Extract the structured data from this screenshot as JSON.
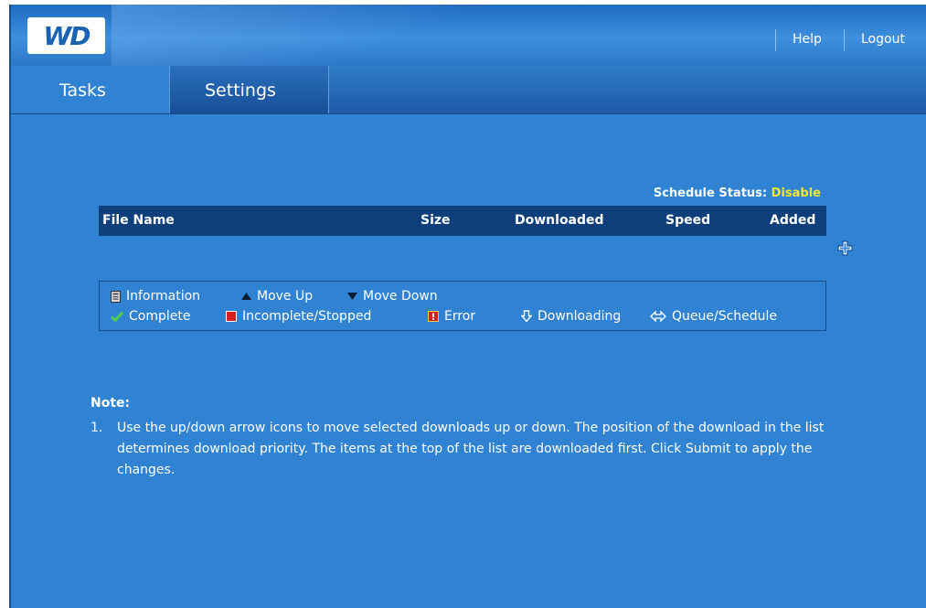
{
  "header": {
    "logo_text": "WD",
    "help_label": "Help",
    "logout_label": "Logout"
  },
  "tabs": [
    {
      "label": "Tasks",
      "active": true
    },
    {
      "label": "Settings",
      "active": false
    }
  ],
  "schedule": {
    "label": "Schedule Status:",
    "value": "Disable",
    "value_color": "#f4e632"
  },
  "table": {
    "columns": [
      "File Name",
      "Size",
      "Downloaded",
      "Speed",
      "Added"
    ],
    "rows": []
  },
  "add_button_icon": "plus-icon",
  "legend": {
    "row1": [
      {
        "icon": "information-icon",
        "label": "Information"
      },
      {
        "icon": "move-up-icon",
        "label": "Move Up"
      },
      {
        "icon": "move-down-icon",
        "label": "Move Down"
      }
    ],
    "row2": [
      {
        "icon": "complete-icon",
        "label": "Complete"
      },
      {
        "icon": "incomplete-stopped-icon",
        "label": "Incomplete/Stopped"
      },
      {
        "icon": "error-icon",
        "label": "Error"
      },
      {
        "icon": "downloading-icon",
        "label": "Downloading"
      },
      {
        "icon": "queue-schedule-icon",
        "label": "Queue/Schedule"
      }
    ]
  },
  "note": {
    "title": "Note:",
    "items": [
      {
        "number": "1.",
        "text": "Use the up/down arrow icons to move selected downloads up or down. The position of the download in the list determines download priority. The items at the top of the list are downloaded first. Click Submit to apply the changes."
      }
    ]
  },
  "colors": {
    "background": "#2f83d2",
    "header_bar": "#0e3f7a",
    "accent_yellow": "#f4e632",
    "complete_green": "#4fd04a",
    "stop_red": "#d42020"
  }
}
